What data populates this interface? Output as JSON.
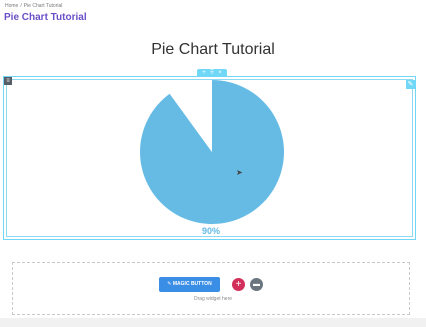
{
  "breadcrumb": {
    "home": "Home",
    "separator": "/",
    "current": "Pie Chart Tutorial"
  },
  "page_title": "Pie Chart Tutorial",
  "content": {
    "heading": "Pie Chart Tutorial"
  },
  "chart_data": {
    "type": "pie",
    "values": [
      90,
      10
    ],
    "colors": [
      "#66bbe5",
      "#ffffff"
    ],
    "label": "90%"
  },
  "controls": {
    "magic_button": "MAGIC BUTTON",
    "drag_hint": "Drag widget here"
  },
  "colors": {
    "title": "#6a4fc8",
    "accent": "#71d7f7",
    "pie": "#66bbe5",
    "add": "#d22f5a",
    "button": "#3a8ee6"
  }
}
